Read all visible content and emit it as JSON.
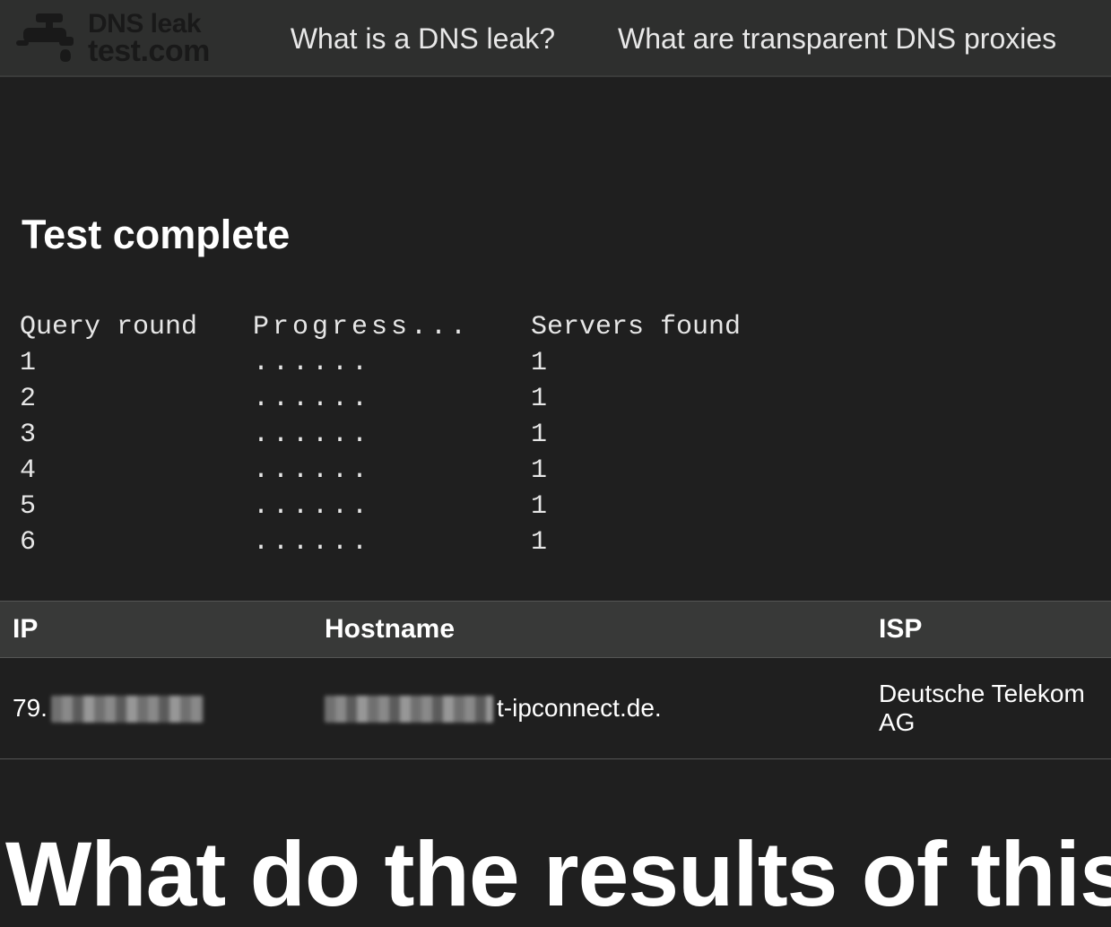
{
  "header": {
    "logo": {
      "line1": "DNS leak",
      "line2": "test.com"
    },
    "nav": {
      "what_is": "What is a DNS leak?",
      "transparent_proxies": "What are transparent DNS proxies"
    }
  },
  "main": {
    "heading": "Test complete",
    "query_table": {
      "headers": {
        "round": "Query round",
        "progress": "Progress...",
        "servers": "Servers found"
      },
      "rows": [
        {
          "round": "1",
          "progress": "......",
          "servers": "1"
        },
        {
          "round": "2",
          "progress": "......",
          "servers": "1"
        },
        {
          "round": "3",
          "progress": "......",
          "servers": "1"
        },
        {
          "round": "4",
          "progress": "......",
          "servers": "1"
        },
        {
          "round": "5",
          "progress": "......",
          "servers": "1"
        },
        {
          "round": "6",
          "progress": "......",
          "servers": "1"
        }
      ]
    },
    "results_table": {
      "headers": {
        "ip": "IP",
        "hostname": "Hostname",
        "isp": "ISP"
      },
      "rows": [
        {
          "ip_prefix": "79.",
          "ip_redacted": true,
          "hostname_redacted_prefix": true,
          "hostname_suffix": "t-ipconnect.de.",
          "isp": "Deutsche Telekom AG"
        }
      ]
    },
    "section_heading": "What do the results of this tes"
  }
}
